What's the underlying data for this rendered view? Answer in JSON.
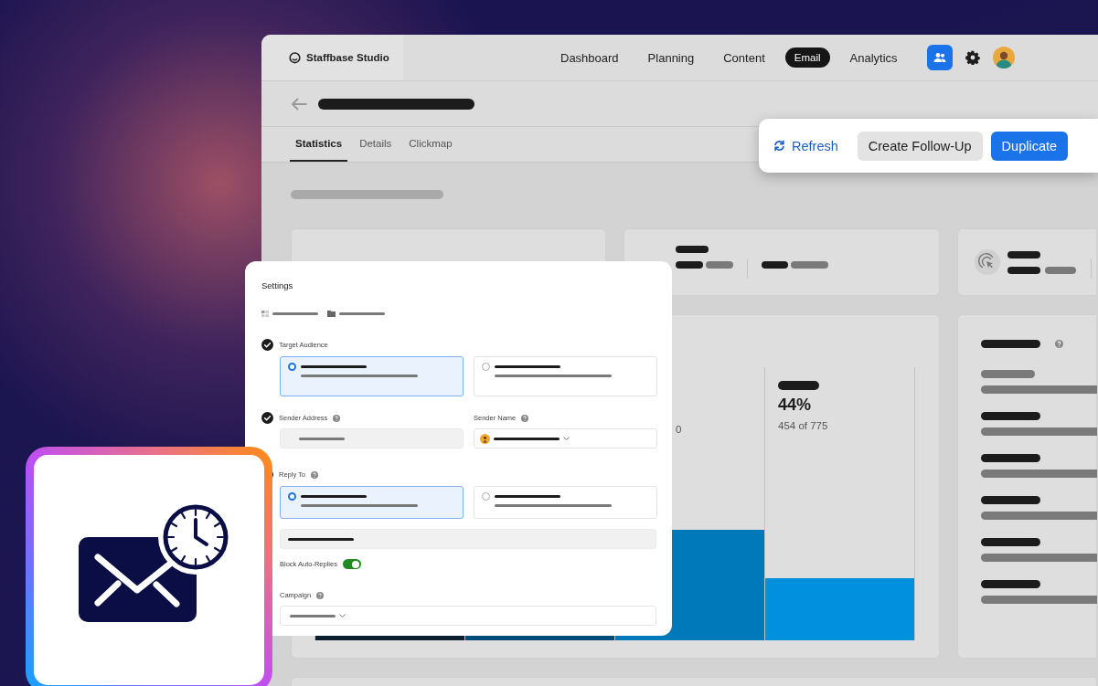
{
  "app": {
    "name": "Staffbase Studio"
  },
  "nav": [
    {
      "label": "Dashboard",
      "selected": false
    },
    {
      "label": "Planning",
      "selected": false
    },
    {
      "label": "Content",
      "selected": false
    },
    {
      "label": "Email",
      "selected": true
    },
    {
      "label": "Analytics",
      "selected": false
    }
  ],
  "actions": [
    {
      "label": "Refresh",
      "kind": "link"
    },
    {
      "label": "Create Follow-Up",
      "kind": "secondary"
    },
    {
      "label": "Duplicate",
      "kind": "primary"
    }
  ],
  "tabs": [
    {
      "label": "Statistics",
      "selected": true
    },
    {
      "label": "Details",
      "selected": false
    },
    {
      "label": "Clickmap",
      "selected": false
    }
  ],
  "funnel": {
    "partial_value": "0",
    "stage": {
      "value": "44%",
      "detail": "454 of 775"
    }
  },
  "settings": {
    "title": "Settings",
    "sections": [
      {
        "kind": "choice",
        "label": "Target Audience",
        "done": true,
        "help": false,
        "options": [
          {
            "selected": true
          },
          {
            "selected": false
          }
        ]
      },
      {
        "kind": "pair",
        "done": true,
        "fields": [
          {
            "kind": "input",
            "label": "Sender Address",
            "help": true
          },
          {
            "kind": "select",
            "label": "Sender Name",
            "help": true
          }
        ]
      },
      {
        "kind": "choice",
        "label": "Reply To",
        "done": true,
        "help": true,
        "options": [
          {
            "selected": true
          },
          {
            "selected": false
          }
        ]
      },
      {
        "kind": "input"
      },
      {
        "kind": "toggle",
        "label": "Block Auto-Replies",
        "on": true
      },
      {
        "kind": "select",
        "label": "Campaign",
        "help": true
      }
    ]
  }
}
